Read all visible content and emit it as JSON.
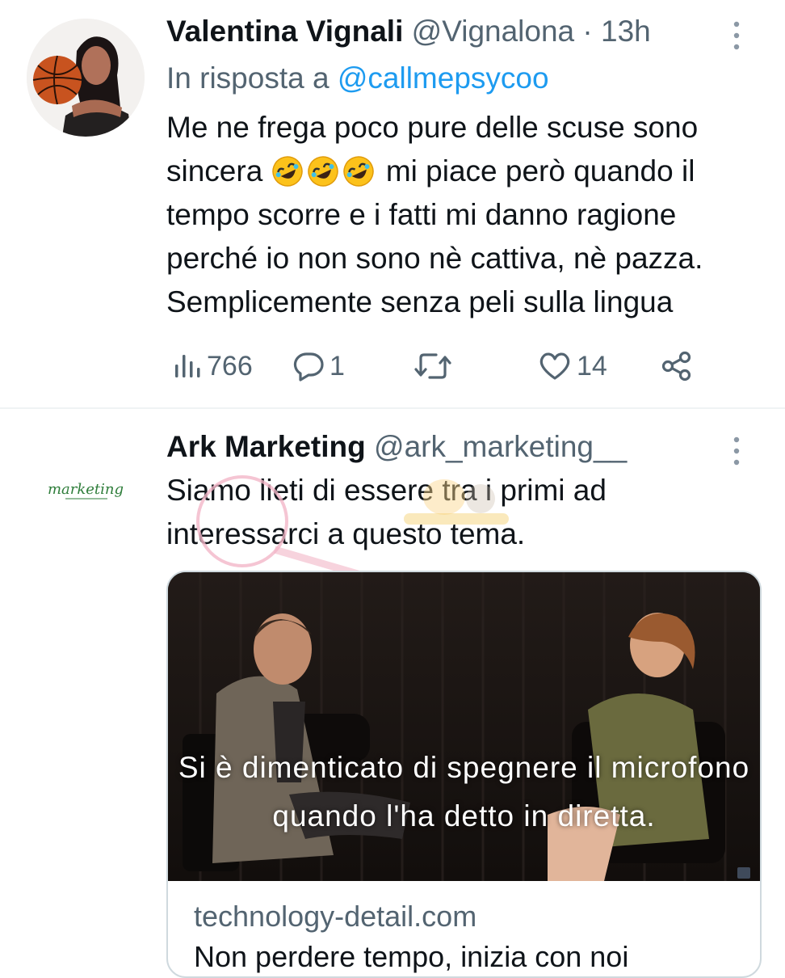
{
  "tweets": [
    {
      "author": {
        "name": "Valentina Vignali",
        "handle": "@Vignalona"
      },
      "separator": "·",
      "time": "13h",
      "reply_prefix": "In risposta a",
      "reply_to": "@callmepsycoo",
      "text_before_emoji": "Me ne frega poco pure delle scuse sono sincera",
      "emoji_name": "rolling-on-floor-laughing",
      "text_after_emoji": "mi piace però quando il tempo scorre e i fatti mi danno ragione perché io non sono nè cattiva, nè pazza. Semplicemente senza peli sulla lingua",
      "actions": {
        "views": "766",
        "replies": "1",
        "retweets": "",
        "likes": "14"
      },
      "more_icon": "ellipsis-vertical-icon"
    },
    {
      "author": {
        "name": "Ark Marketing",
        "handle": "@ark_marketing__"
      },
      "text": "Siamo lieti di essere tra i primi ad interessarci a questo tema.",
      "avatar_logo_text": "marketing",
      "card": {
        "video_caption": "Si è dimenticato di spegnere il microfono quando l'ha detto in diretta.",
        "domain": "technology-detail.com",
        "title": "Non perdere tempo, inizia con noi"
      },
      "more_icon": "ellipsis-vertical-icon"
    }
  ],
  "colors": {
    "accent": "#1d9bf0",
    "secondary_text": "#536471",
    "text": "#0f1419",
    "divider": "#eff3f4"
  }
}
